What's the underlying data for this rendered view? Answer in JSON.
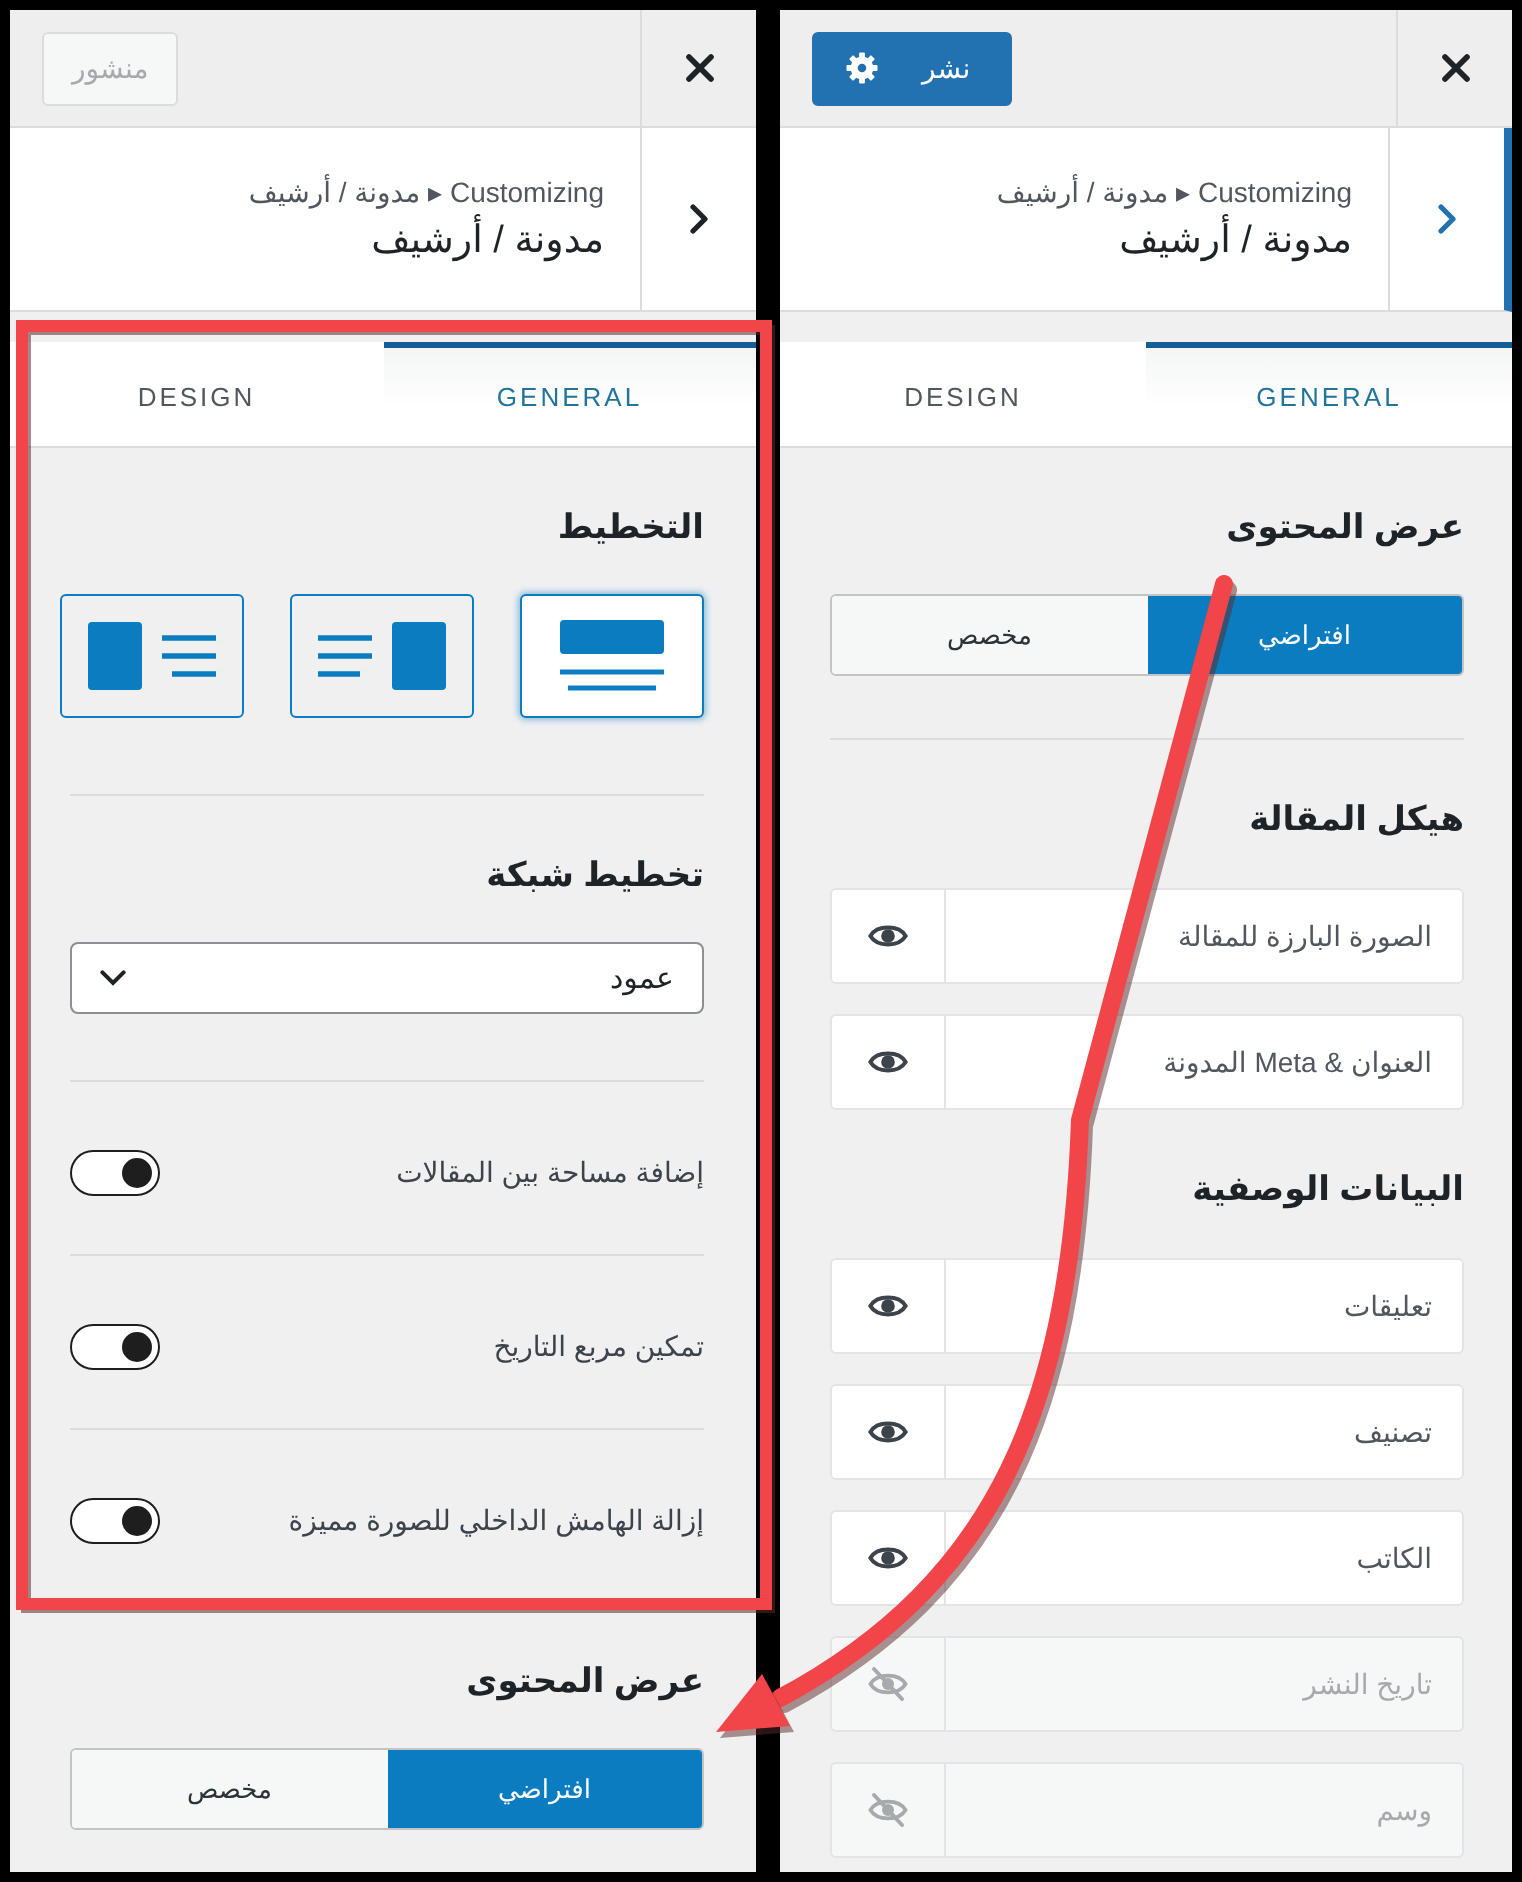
{
  "panels": [
    {
      "header": {
        "publish_button": {
          "label": "نشر",
          "disabled": false,
          "gear": true
        }
      },
      "breadcrumb": {
        "path": "Customizing ▸ مدونة / أرشيف",
        "title": "مدونة / أرشيف",
        "focused": true
      },
      "tabs": [
        {
          "label": "GENERAL",
          "selected": true
        },
        {
          "label": "DESIGN",
          "selected": false
        }
      ],
      "sections": [
        {
          "kind": "segmented",
          "title": "عرض المحتوى",
          "divider": true,
          "options": [
            {
              "label": "افتراضي",
              "selected": true
            },
            {
              "label": "مخصص",
              "selected": false
            }
          ]
        },
        {
          "kind": "sortable",
          "title": "هيكل المقالة",
          "divider": false,
          "items": [
            {
              "label": "الصورة البارزة للمقالة",
              "visible": true
            },
            {
              "label": "العنوان & Meta المدونة",
              "visible": true
            }
          ]
        },
        {
          "kind": "sortable",
          "title": "البيانات الوصفية",
          "divider": false,
          "items": [
            {
              "label": "تعليقات",
              "visible": true
            },
            {
              "label": "تصنيف",
              "visible": true
            },
            {
              "label": "الكاتب",
              "visible": true
            },
            {
              "label": "تاريخ النشر",
              "visible": false
            },
            {
              "label": "وسم",
              "visible": false
            }
          ]
        }
      ]
    },
    {
      "header": {
        "publish_button": {
          "label": "منشور",
          "disabled": true,
          "gear": false
        }
      },
      "breadcrumb": {
        "path": "Customizing ▸ مدونة / أرشيف",
        "title": "مدونة / أرشيف",
        "focused": false
      },
      "tabs": [
        {
          "label": "GENERAL",
          "selected": true
        },
        {
          "label": "DESIGN",
          "selected": false
        }
      ],
      "sections": [
        {
          "kind": "layout_picker",
          "title": "التخطيط",
          "divider": true,
          "options": [
            {
              "kind": "image_top",
              "selected": true
            },
            {
              "kind": "image_right",
              "selected": false
            },
            {
              "kind": "image_left",
              "selected": false
            }
          ]
        },
        {
          "kind": "select",
          "title": "تخطيط شبكة",
          "value": "عمود",
          "divider": true
        },
        {
          "kind": "toggle",
          "label": "إضافة مساحة بين المقالات",
          "on": true,
          "divider": true
        },
        {
          "kind": "toggle",
          "label": "تمكين مربع التاريخ",
          "on": true,
          "divider": true
        },
        {
          "kind": "toggle",
          "label": "إزالة الهامش الداخلي للصورة مميزة",
          "on": true,
          "divider": false
        },
        {
          "kind": "segmented",
          "title": "عرض المحتوى",
          "divider": false,
          "options": [
            {
              "label": "افتراضي",
              "selected": true
            },
            {
              "label": "مخصص",
              "selected": false
            }
          ]
        }
      ]
    }
  ],
  "annotations": {
    "highlight_frame": true,
    "arrow": true
  }
}
